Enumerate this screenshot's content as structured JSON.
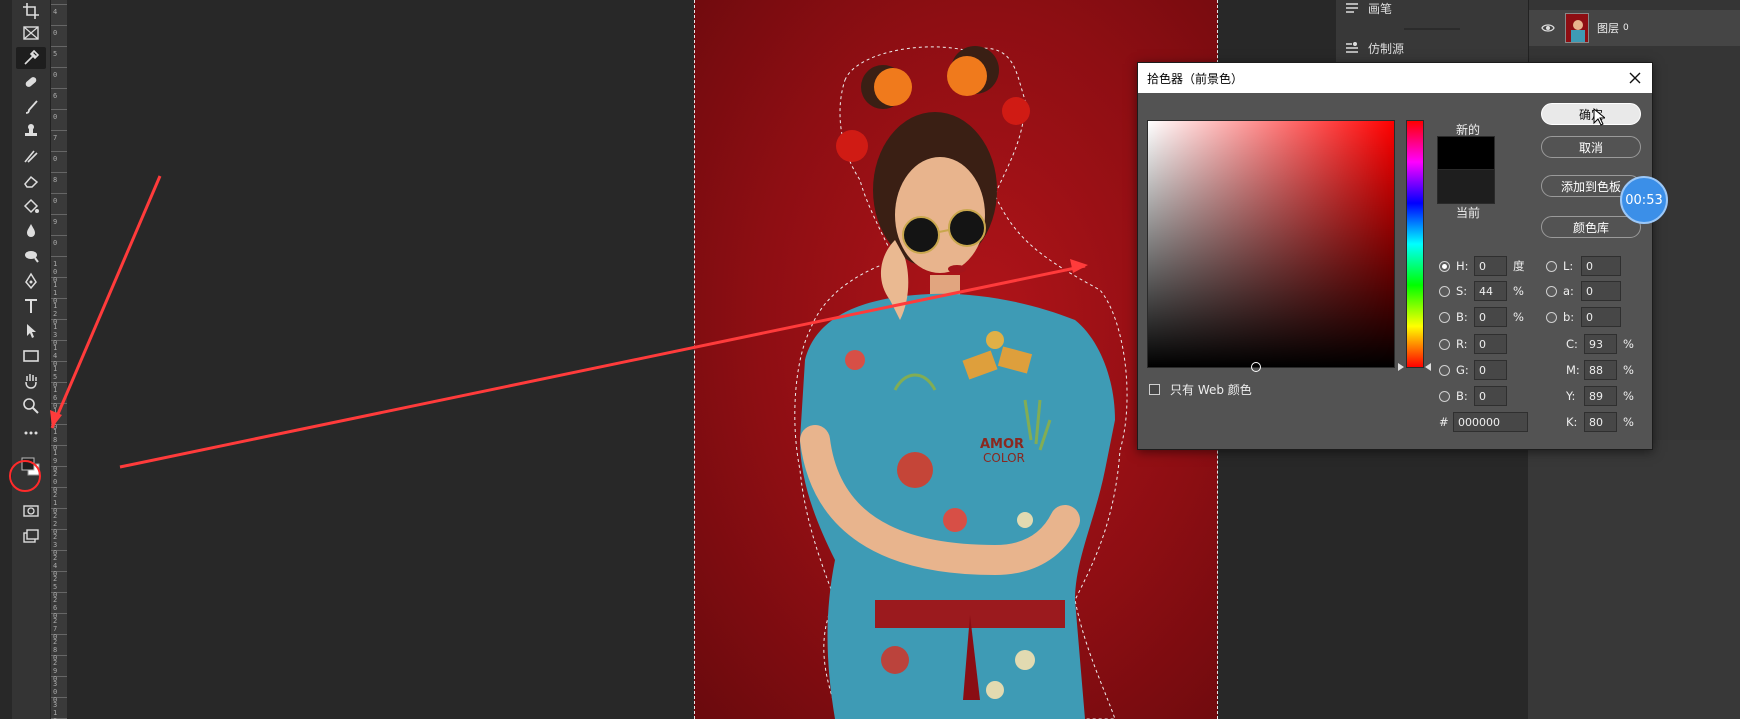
{
  "panels": {
    "brush_label": "画笔",
    "clone_source_label": "仿制源",
    "layer_name": "图层",
    "layer_index": "0"
  },
  "dialog": {
    "title": "拾色器（前景色）",
    "swatch_new_label": "新的",
    "swatch_current_label": "当前",
    "buttons": {
      "ok": "确定",
      "cancel": "取消",
      "add_to_swatches": "添加到色板",
      "color_libraries": "颜色库"
    },
    "web_only_label": "只有 Web 颜色",
    "selected_mode": "H",
    "hsb": {
      "h_label": "H:",
      "h_value": "0",
      "h_unit": "度",
      "s_label": "S:",
      "s_value": "44",
      "s_unit": "%",
      "b_label": "B:",
      "b_value": "0",
      "b_unit": "%"
    },
    "lab": {
      "l_label": "L:",
      "l_value": "0",
      "a_label": "a:",
      "a_value": "0",
      "b_label": "b:",
      "b_value": "0"
    },
    "rgb": {
      "r_label": "R:",
      "r_value": "0",
      "g_label": "G:",
      "g_value": "0",
      "b_label": "B:",
      "b_value": "0"
    },
    "cmyk": {
      "c_label": "C:",
      "c_value": "93",
      "m_label": "M:",
      "m_value": "88",
      "y_label": "Y:",
      "y_value": "89",
      "k_label": "K:",
      "k_value": "80",
      "unit": "%"
    },
    "hex_label": "#",
    "hex_value": "000000",
    "new_color": "#000000",
    "current_color": "#1e1e1e"
  },
  "timer": "00:53",
  "ruler_labels": [
    "4",
    "0",
    "5",
    "0",
    "6",
    "0",
    "7",
    "0",
    "8",
    "0",
    "9",
    "0",
    "1 0 0",
    "1 1 0",
    "1 2 0",
    "1 3 0",
    "1 4 0",
    "1 5 0",
    "1 6 0",
    "1 7 0",
    "1 8 0",
    "1 9 0",
    "2 0 0",
    "2 1 0",
    "2 2 0",
    "2 3 0",
    "2 4 0",
    "2 5 0",
    "2 6 0",
    "2 7 0",
    "2 8 0",
    "2 9 0",
    "3 0 0",
    "3 1 0"
  ],
  "colors": {
    "canvas_background": "#8e0e13",
    "annotation_arrow": "#ff3b3b",
    "timer_bubble": "#3b8fe8"
  },
  "toolbar_icons": [
    "crop-icon",
    "frame-icon",
    "eyedropper-icon",
    "healing-brush-icon",
    "brush-icon",
    "stamp-icon",
    "history-brush-icon",
    "eraser-icon",
    "paint-bucket-icon",
    "blur-icon",
    "dodge-icon",
    "pen-icon",
    "type-icon",
    "path-select-icon",
    "rectangle-icon",
    "hand-icon",
    "zoom-icon",
    "more-tools-icon",
    "color-swatches-icon",
    "quick-mask-icon",
    "screen-mode-icon"
  ]
}
